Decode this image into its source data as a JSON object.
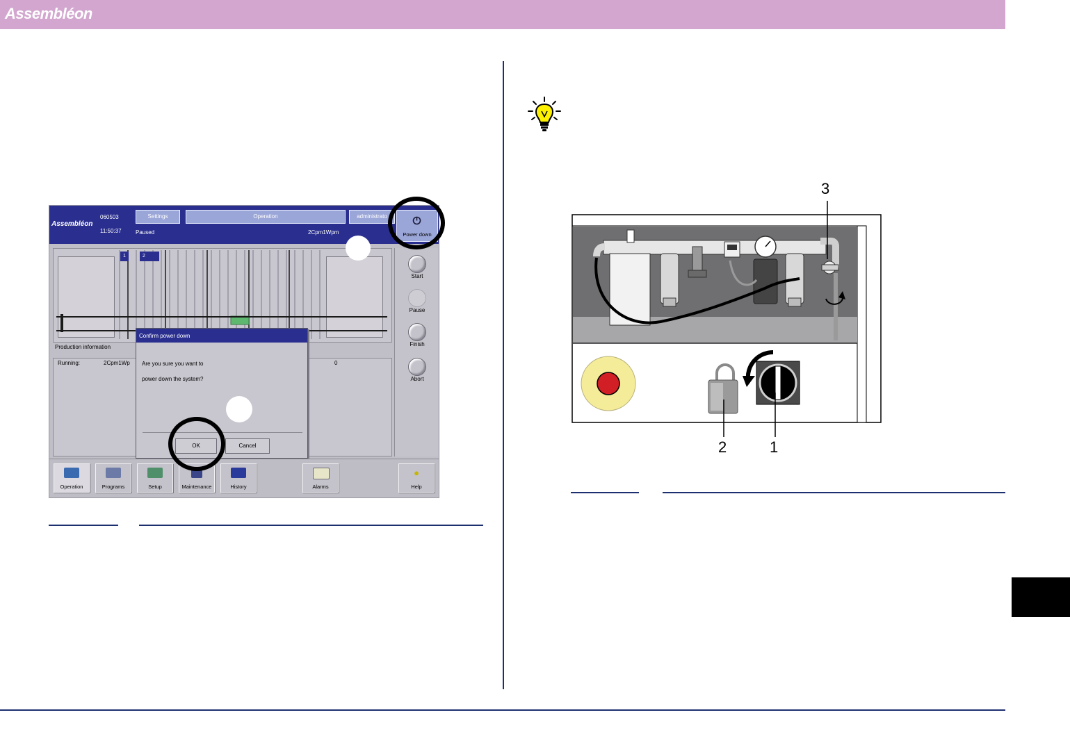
{
  "header": {
    "brand": "Assembléon",
    "bar_color": "#d2a6cf",
    "rule_color": "#1c2f6e"
  },
  "screenshot": {
    "logo": "Assembléon",
    "date": "060503",
    "time": "11:50:37",
    "status": "Paused",
    "program": "2Cpm1Wpm",
    "settings_label": "Settings",
    "operation_label": "Operation",
    "user_label": "administrato",
    "power_down_label": "Power down",
    "slot_labels": [
      "1",
      "2"
    ],
    "right_buttons": [
      "Start",
      "Pause",
      "Finish",
      "Abort"
    ],
    "production_info_label": "Production information",
    "running_label": "Running:",
    "running_value": "2Cpm1Wp",
    "count_value": "0",
    "dialog": {
      "title": "Confirm power down",
      "line1": "Are you sure you want to",
      "line2": "power down the system?",
      "ok_label": "OK",
      "cancel_label": "Cancel"
    },
    "toolbar": [
      "Operation",
      "Programs",
      "Setup",
      "Maintenance",
      "History",
      "Alarms",
      "Help"
    ]
  },
  "figure": {
    "callouts": [
      "3",
      "2",
      "1"
    ],
    "tip_icon": "lightbulb-icon"
  }
}
